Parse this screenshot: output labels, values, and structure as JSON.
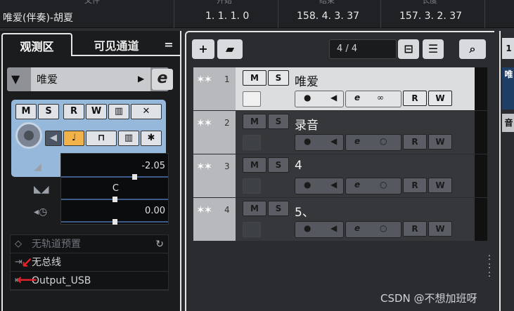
{
  "top": {
    "song": "唯爱(伴奏)-胡夏",
    "start": "1. 1. 1.  0",
    "end": "158. 4. 3. 37",
    "length": "157. 3. 2. 37",
    "hdr_file": "文件",
    "hdr_start": "开始",
    "hdr_end": "结束",
    "hdr_length": "长度"
  },
  "inspector": {
    "tab_active": "观测区",
    "tab_visible": "可见通道",
    "tab_menu": "=",
    "track_name": "唯爱",
    "edit_glyph": "e",
    "volume_value": "-2.05",
    "pan_label": "C",
    "delay_value": "0.00",
    "preset_label": "无轨道预置",
    "input_label": "无总线",
    "output_label": "Output_USB"
  },
  "tracklist": {
    "count": "4 / 4",
    "tracks": [
      {
        "num": "1",
        "name": "唯爱",
        "mute": "M",
        "solo": "S",
        "read": "R",
        "write": "W",
        "edit": "e"
      },
      {
        "num": "2",
        "name": "录音",
        "mute": "M",
        "solo": "S",
        "read": "R",
        "write": "W",
        "edit": "e"
      },
      {
        "num": "3",
        "name": "4",
        "mute": "M",
        "solo": "S",
        "read": "R",
        "write": "W",
        "edit": "e"
      },
      {
        "num": "4",
        "name": "5、",
        "mute": "M",
        "solo": "S",
        "read": "R",
        "write": "W",
        "edit": "e"
      }
    ]
  },
  "panel_buttons": {
    "m": "M",
    "s": "S",
    "r": "R",
    "w": "W"
  },
  "right": {
    "top_label": "1",
    "sub_label": "唯",
    "third_label": "音"
  },
  "watermark": "CSDN @不想加班呀"
}
